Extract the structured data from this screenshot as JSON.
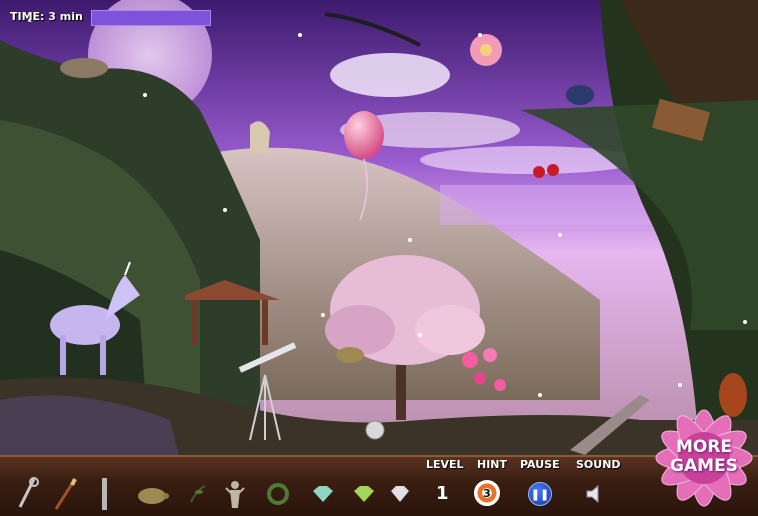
{
  "hud": {
    "time_label": "TIME: 3 min",
    "timer_fraction": 1.0
  },
  "controls": {
    "level_label": "LEVEL",
    "level_value": "1",
    "hint_label": "HINT",
    "hint_count": "3",
    "pause_label": "PAUSE",
    "sound_label": "SOUND",
    "pause_icon": "pause-icon",
    "sound_icon": "speaker-icon"
  },
  "more_games": {
    "line1": "MORE",
    "line2": "GAMES"
  },
  "items_to_find": [
    {
      "icon": "key-icon"
    },
    {
      "icon": "paintbrush-icon"
    },
    {
      "icon": "flute-icon"
    },
    {
      "icon": "turtle-icon"
    },
    {
      "icon": "leaf-sprig-icon"
    },
    {
      "icon": "fairy-statue-icon"
    },
    {
      "icon": "wreath-icon"
    },
    {
      "icon": "gem-icon"
    },
    {
      "icon": "gem-green-icon"
    },
    {
      "icon": "crystal-icon"
    }
  ],
  "colors": {
    "sky_top": "#4a1f7a",
    "sky_mid": "#a86bd6",
    "toolbar": "#3a1e12",
    "timer_bar": "#6a3ec4",
    "accent_pink": "#e55aa8"
  }
}
